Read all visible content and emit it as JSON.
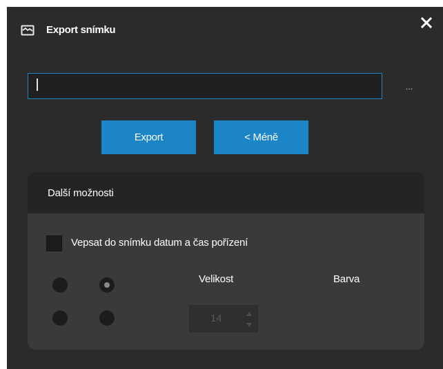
{
  "dialog": {
    "title": "Export snímku",
    "icon": "image-icon",
    "close_icon": "close-icon"
  },
  "path": {
    "value": "",
    "browse_label": "..."
  },
  "buttons": {
    "export_label": "Export",
    "less_label": "< Méně"
  },
  "options": {
    "title": "Další možnosti",
    "imprint_checkbox_label": "Vepsat do snímku datum a čas pořízení",
    "imprint_checked": false,
    "position_radios": [
      {
        "checked": false
      },
      {
        "checked": true
      },
      {
        "checked": false
      },
      {
        "checked": false
      }
    ],
    "size_label": "Velikost",
    "color_label": "Barva",
    "size_value": "14"
  },
  "colors": {
    "accent": "#1b85c7",
    "dialog_bg": "#2b2b2b",
    "panel_bg": "#3a3a3a",
    "panel_header_bg": "#242424"
  }
}
